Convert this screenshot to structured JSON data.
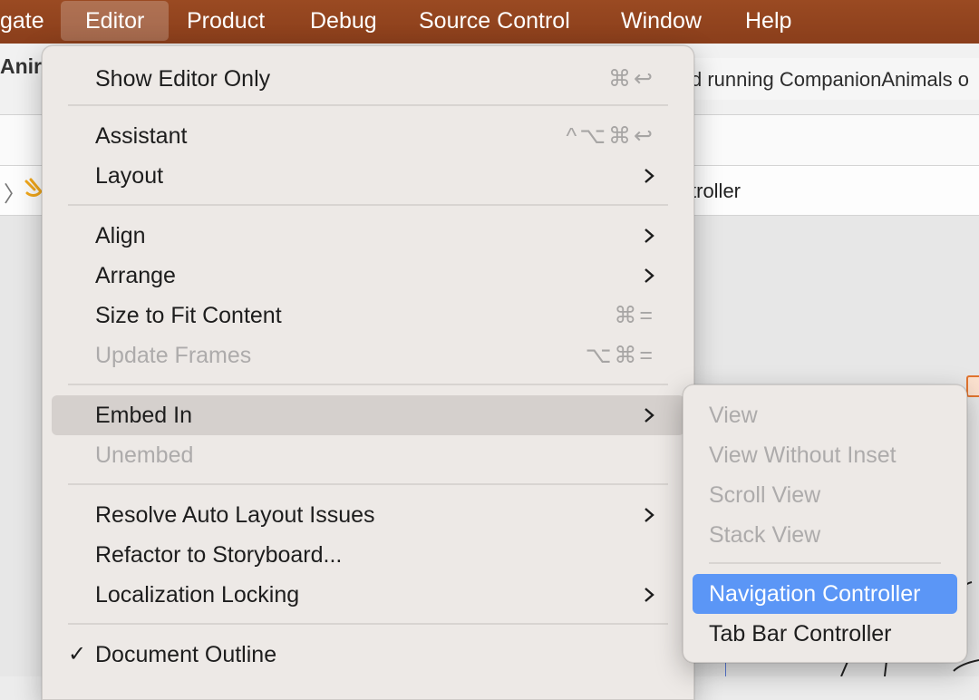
{
  "menubar": {
    "items": [
      {
        "label": "gate"
      },
      {
        "label": "Editor"
      },
      {
        "label": "Product"
      },
      {
        "label": "Debug"
      },
      {
        "label": "Source Control"
      },
      {
        "label": "Window"
      },
      {
        "label": "Help"
      }
    ],
    "active_index": 1
  },
  "window": {
    "scheme_title": "Anir",
    "activity_status": "d running CompanionAnimals o",
    "jumpbar_text": "troller"
  },
  "editor_menu": {
    "items": [
      {
        "label": "Show Editor Only",
        "shortcut": "⌘↩"
      },
      {
        "label": "Assistant",
        "shortcut": "^⌥⌘↩"
      },
      {
        "label": "Layout"
      },
      {
        "label": "Align"
      },
      {
        "label": "Arrange"
      },
      {
        "label": "Size to Fit Content",
        "shortcut": "⌘="
      },
      {
        "label": "Update Frames",
        "shortcut": "⌥⌘="
      },
      {
        "label": "Embed In"
      },
      {
        "label": "Unembed"
      },
      {
        "label": "Resolve Auto Layout Issues"
      },
      {
        "label": "Refactor to Storyboard..."
      },
      {
        "label": "Localization Locking"
      },
      {
        "label": "Document Outline",
        "check": "✓"
      }
    ]
  },
  "embed_submenu": {
    "items": [
      {
        "label": "View"
      },
      {
        "label": "View Without Inset"
      },
      {
        "label": "Scroll View"
      },
      {
        "label": "Stack View"
      },
      {
        "label": "Navigation Controller"
      },
      {
        "label": "Tab Bar Controller"
      }
    ]
  },
  "colors": {
    "menubar": "#8a3e1b",
    "menu_background": "#ede9e6",
    "highlight": "#d5d0cd",
    "selected": "#5b96f6",
    "disabled_text": "#adabab"
  }
}
